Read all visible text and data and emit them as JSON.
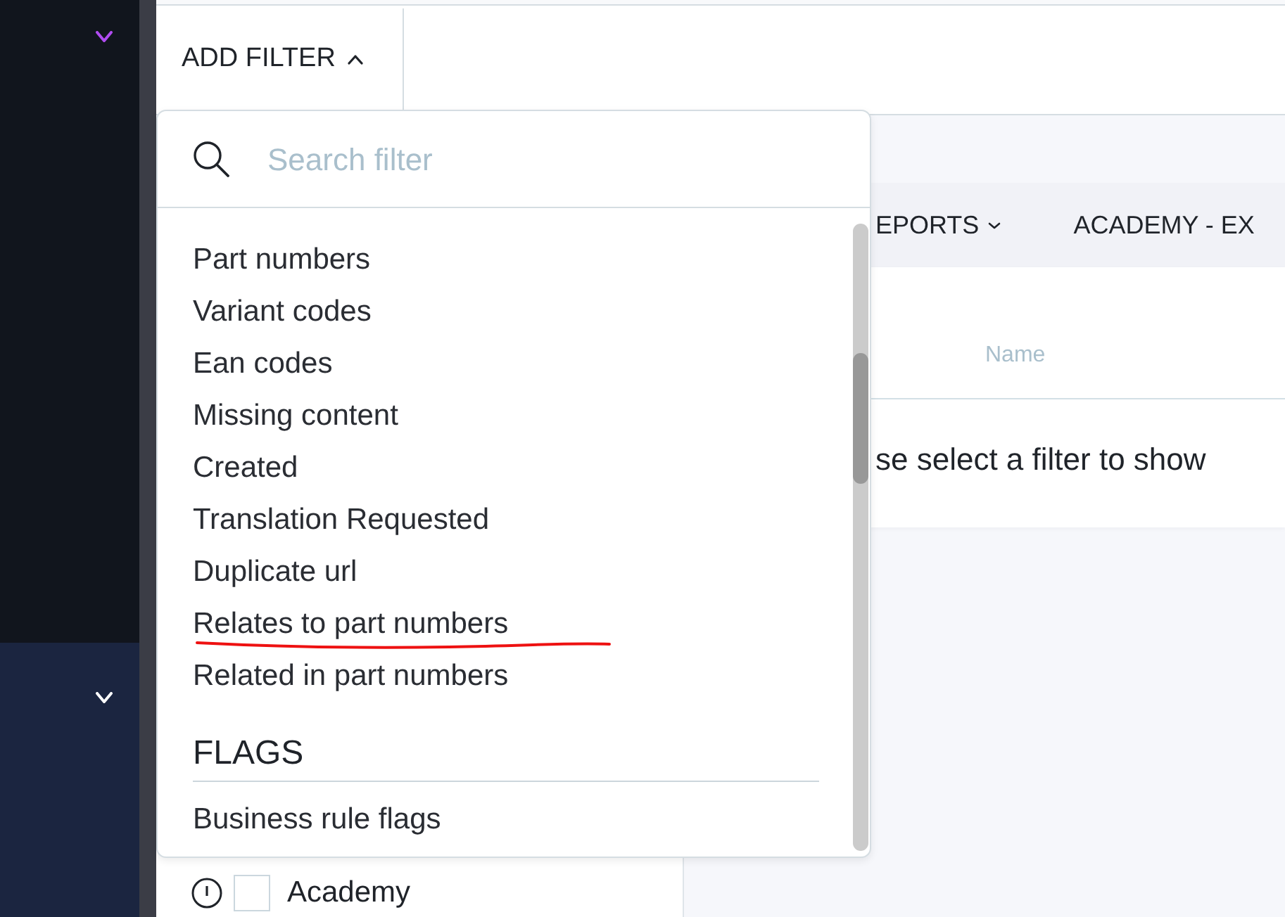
{
  "sidebar": {
    "groups": [
      {
        "selected": true
      },
      {
        "selected": false
      }
    ]
  },
  "toolbar": {
    "add_filter": {
      "label": "ADD FILTER",
      "expanded": true
    }
  },
  "filter_dropdown": {
    "search": {
      "placeholder": "Search filter"
    },
    "sections": [
      {
        "items": [
          {
            "label": "Part numbers",
            "marked": false
          },
          {
            "label": "Variant codes",
            "marked": false
          },
          {
            "label": "Ean codes",
            "marked": false
          },
          {
            "label": "Missing content",
            "marked": false
          },
          {
            "label": "Created",
            "marked": false
          },
          {
            "label": "Translation Requested",
            "marked": false
          },
          {
            "label": "Duplicate url",
            "marked": false
          },
          {
            "label": "Relates to part numbers",
            "marked": true
          },
          {
            "label": "Related in part numbers",
            "marked": false
          }
        ]
      },
      {
        "heading": "FLAGS",
        "items": [
          {
            "label": "Business rule flags",
            "marked": false
          }
        ]
      }
    ]
  },
  "left_panel": {
    "rows": [
      {
        "label": "Academy",
        "checked": false
      }
    ]
  },
  "tabs": [
    {
      "label": "EPORTS",
      "kind": "dropdown"
    },
    {
      "label": "ACADEMY - EX",
      "kind": "plain"
    }
  ],
  "table": {
    "columns": [
      "Name"
    ],
    "empty_message": "se select a filter to show"
  }
}
